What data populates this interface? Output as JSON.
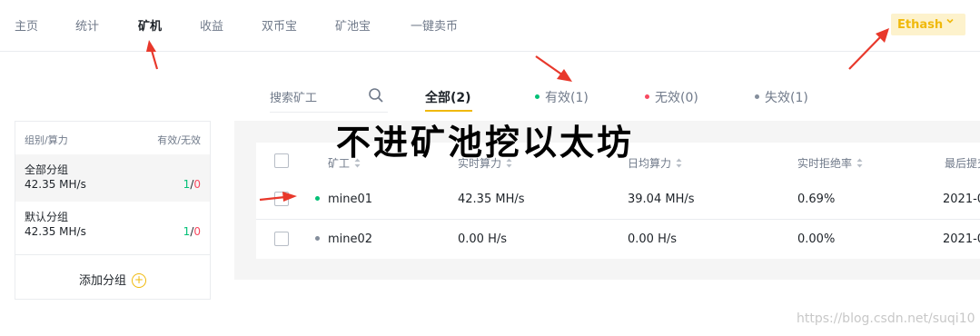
{
  "nav": {
    "items": [
      {
        "label": "主页"
      },
      {
        "label": "统计"
      },
      {
        "label": "矿机"
      },
      {
        "label": "收益"
      },
      {
        "label": "双币宝"
      },
      {
        "label": "矿池宝"
      },
      {
        "label": "一键卖币"
      }
    ],
    "active": "矿机"
  },
  "algorithm": {
    "selected": "Ethash"
  },
  "search": {
    "placeholder": "搜索矿工"
  },
  "filters": {
    "all": "全部(2)",
    "valid": "有效(1)",
    "invalid": "无效(0)",
    "lost": "失效(1)"
  },
  "groups": {
    "header_left": "组别/算力",
    "header_right": "有效/无效",
    "items": [
      {
        "name": "全部分组",
        "hashrate": "42.35 MH/s",
        "valid": "1",
        "sep": "/",
        "invalid": "0"
      },
      {
        "name": "默认分组",
        "hashrate": "42.35 MH/s",
        "valid": "1",
        "sep": "/",
        "invalid": "0"
      }
    ],
    "add_label": "添加分组",
    "add_icon": "+"
  },
  "table": {
    "columns": [
      "矿工",
      "实时算力",
      "日均算力",
      "实时拒绝率",
      "最后提交"
    ],
    "rows": [
      {
        "status": "valid",
        "worker": "mine01",
        "realtime": "42.35 MH/s",
        "daily": "39.04 MH/s",
        "reject": "0.69%",
        "last": "2021-0"
      },
      {
        "status": "lost",
        "worker": "mine02",
        "realtime": "0.00 H/s",
        "daily": "0.00 H/s",
        "reject": "0.00%",
        "last": "2021-0"
      }
    ]
  },
  "overlay": {
    "title": "不进矿池挖以太坊",
    "watermark": "https://blog.csdn.net/suqi10"
  },
  "colors": {
    "accent": "#f0b90b",
    "valid": "#02c076",
    "invalid": "#f84960",
    "lost": "#848e9c",
    "arrow": "#e8382b"
  }
}
